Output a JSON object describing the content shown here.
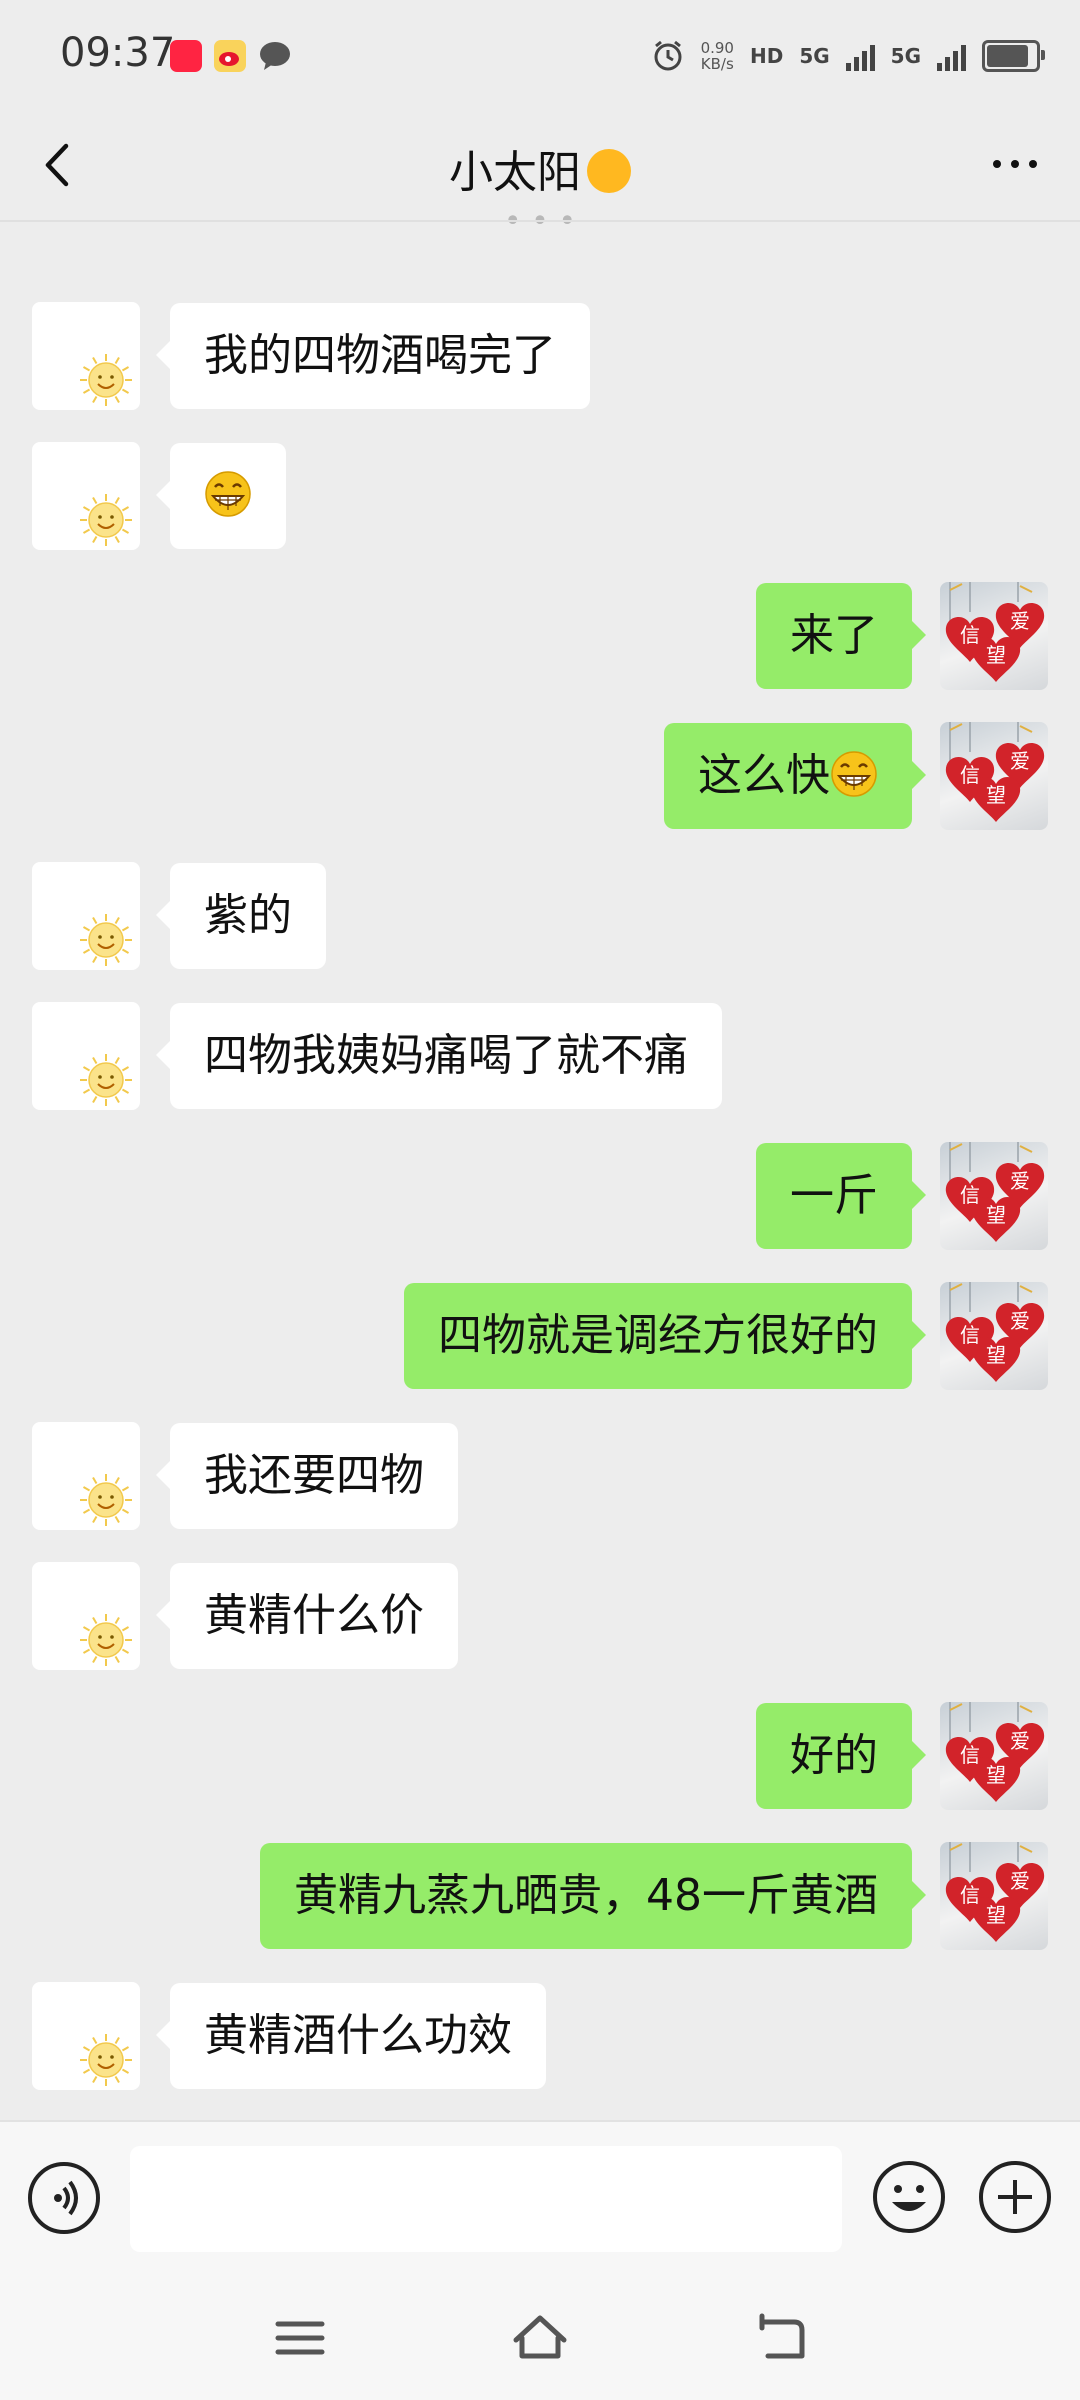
{
  "status_bar": {
    "time": "09:37",
    "net_speed_value": "0.90",
    "net_speed_unit": "KB/s",
    "hd_label": "HD",
    "sim1_label": "5G",
    "sim2_label": "5G",
    "app_icons": [
      "xiaohongshu-icon",
      "weibo-icon",
      "message-icon"
    ],
    "battery_level": 0.85
  },
  "header": {
    "title": "小太阳"
  },
  "chat": {
    "messages": [
      {
        "side": "left",
        "text": "我的四物酒喝完了"
      },
      {
        "side": "left",
        "text": "",
        "emoji": "grin-emoji"
      },
      {
        "side": "right",
        "text": "来了"
      },
      {
        "side": "right",
        "text": "这么快",
        "emoji": "grin-emoji"
      },
      {
        "side": "left",
        "text": "紫的"
      },
      {
        "side": "left",
        "text": "四物我姨妈痛喝了就不痛"
      },
      {
        "side": "right",
        "text": "一斤"
      },
      {
        "side": "right",
        "text": "四物就是调经方很好的"
      },
      {
        "side": "left",
        "text": "我还要四物"
      },
      {
        "side": "left",
        "text": "黄精什么价"
      },
      {
        "side": "right",
        "text": "好的"
      },
      {
        "side": "right",
        "text": "黄精九蒸九晒贵，48一斤黄酒"
      },
      {
        "side": "left",
        "text": "黄精酒什么功效"
      }
    ],
    "my_avatar_chars": [
      "信",
      "爱",
      "望"
    ]
  },
  "input_bar": {
    "placeholder": ""
  },
  "colors": {
    "background": "#ededed",
    "my_bubble": "#95ec69",
    "their_bubble": "#ffffff",
    "heart_red": "#d2232a"
  }
}
